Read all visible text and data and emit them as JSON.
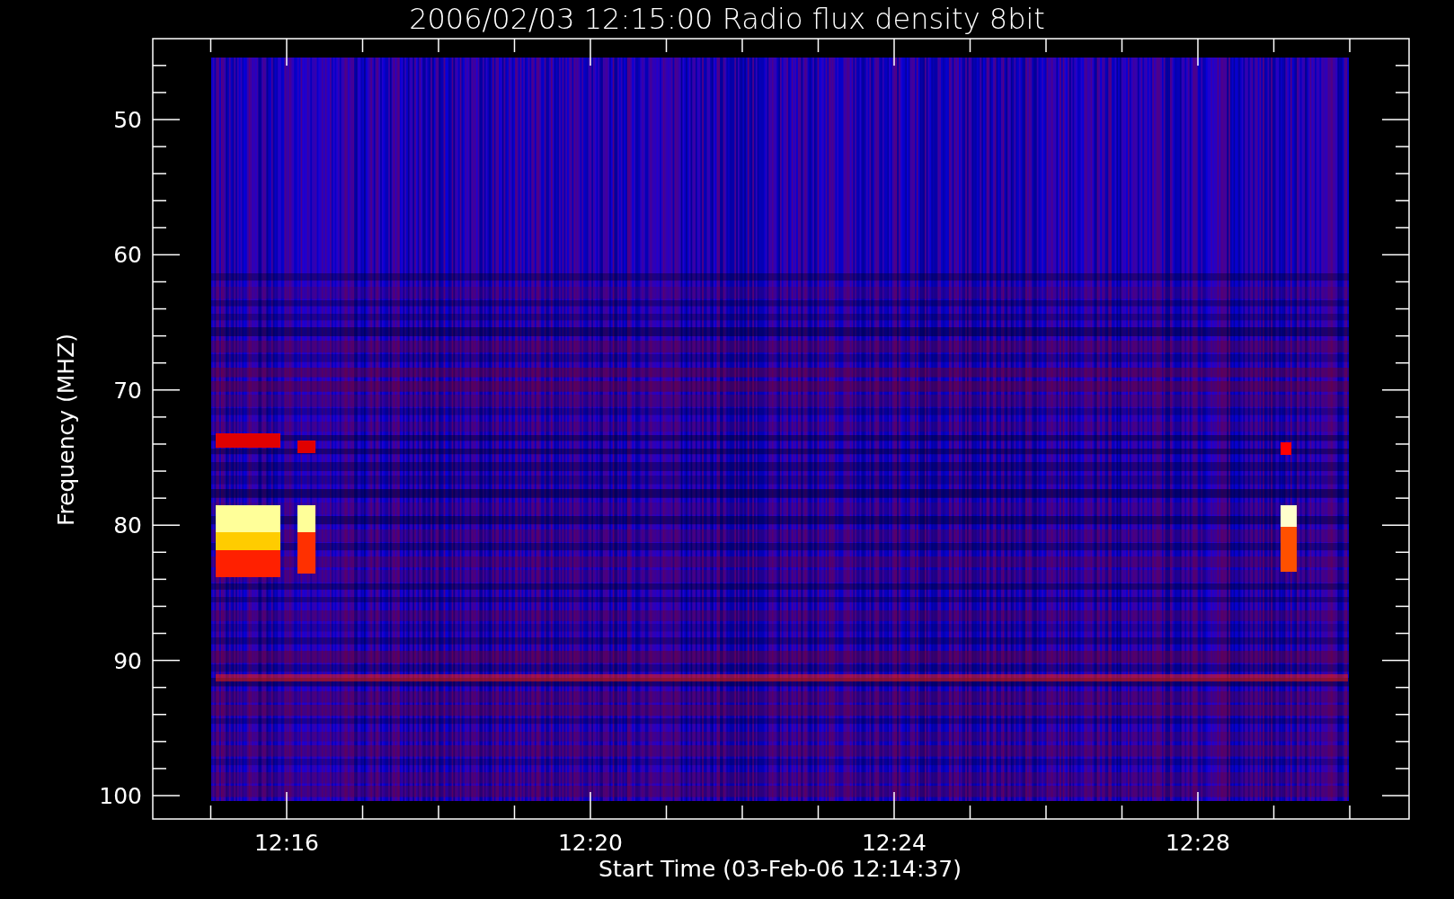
{
  "title": "2006/02/03 12:15:00 Radio flux density 8bit",
  "y_axis": {
    "label": "Frequency (MHZ)",
    "ticks": [
      "50",
      "60",
      "70",
      "80",
      "90",
      "100"
    ]
  },
  "x_axis": {
    "label": "Start Time (03-Feb-06 12:14:37)",
    "ticks": [
      "12:16",
      "12:20",
      "12:24",
      "12:28"
    ]
  }
}
